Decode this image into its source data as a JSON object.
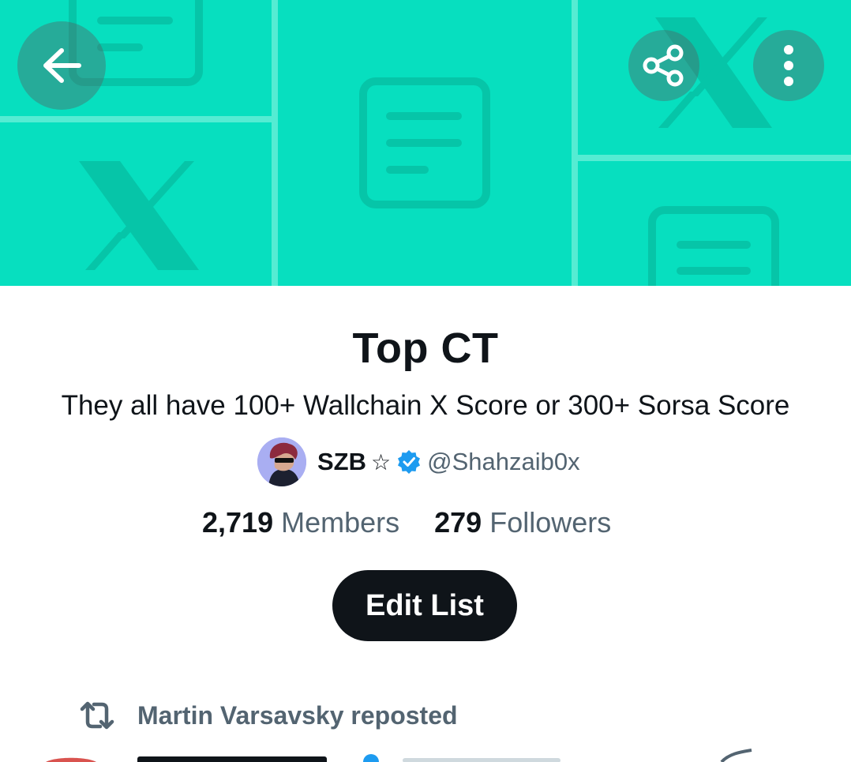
{
  "header": {
    "back_icon": "arrow-left-icon",
    "share_icon": "share-icon",
    "more_icon": "more-vertical-icon",
    "banner_color": "#07dfbf"
  },
  "list": {
    "title": "Top CT",
    "description": "They all have 100+ Wallchain X Score or 300+ Sorsa Score",
    "owner": {
      "name": "SZB",
      "star": "☆",
      "verified": true,
      "handle": "@Shahzaib0x"
    },
    "stats": {
      "members_count": "2,719",
      "members_label": "Members",
      "followers_count": "279",
      "followers_label": "Followers"
    },
    "edit_button_label": "Edit List"
  },
  "timeline": {
    "repost_label": "Martin Varsavsky reposted"
  },
  "colors": {
    "text_primary": "#0f1419",
    "text_secondary": "#536471",
    "verified_blue": "#1d9bf0",
    "button_dark": "#0f1419"
  }
}
